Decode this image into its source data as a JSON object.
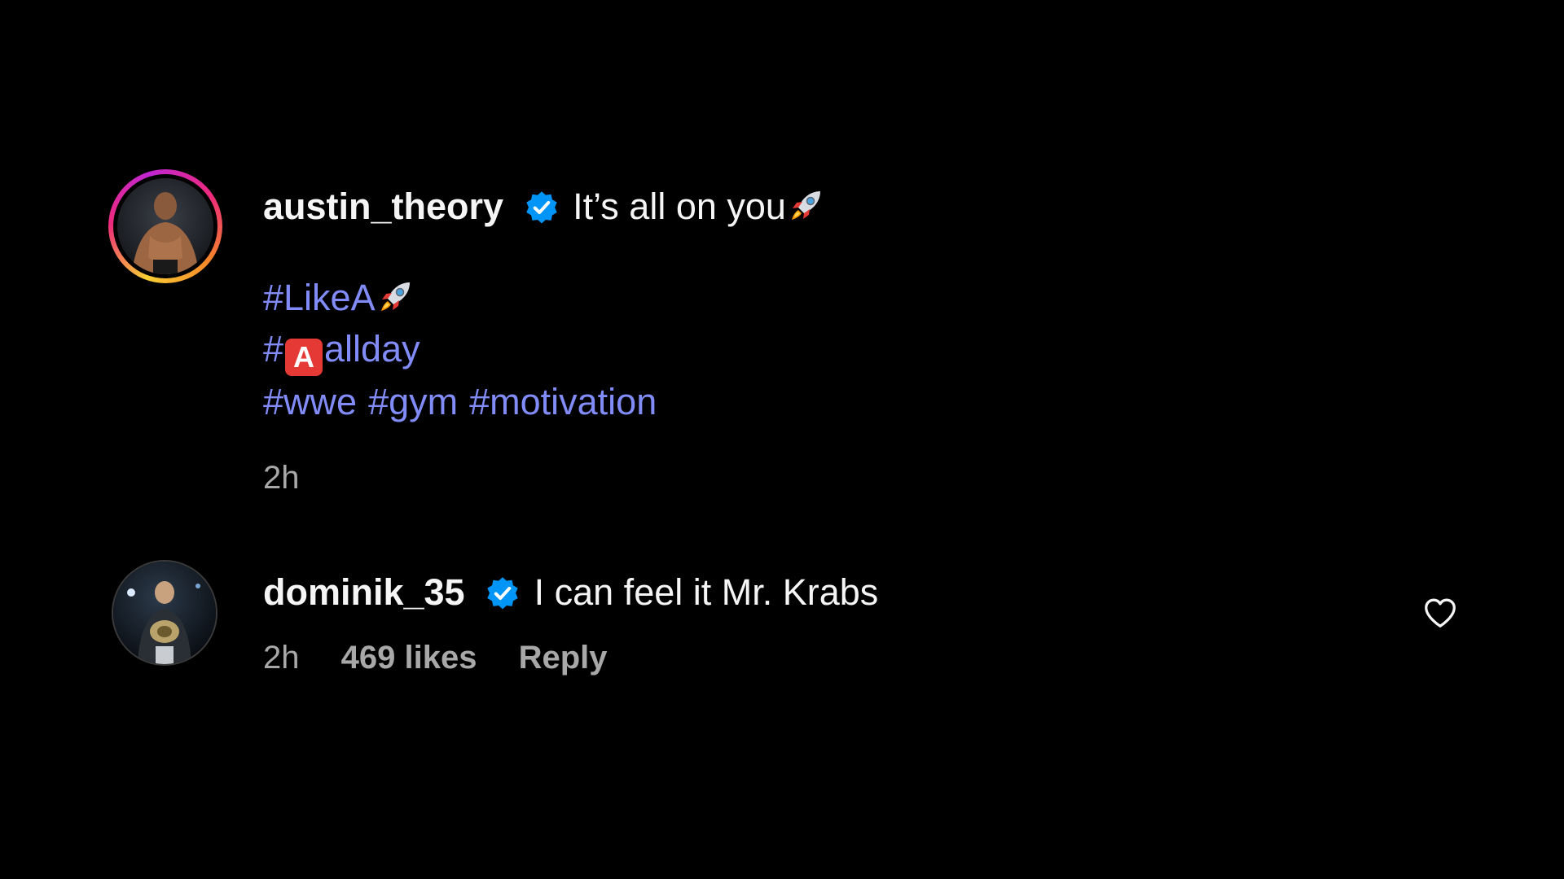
{
  "post": {
    "username": "austin_theory",
    "caption": "It’s all on you",
    "hashtags_line1": "#LikeA",
    "hashtags_line2_prefix": "#",
    "hashtags_line2_suffix": "allday",
    "hashtags_line2_emoji": "A",
    "hashtags_line3": [
      "#wwe",
      "#gym",
      "#motivation"
    ],
    "time": "2h"
  },
  "comment": {
    "username": "dominik_35",
    "text": "I can feel it Mr. Krabs",
    "time": "2h",
    "likes": "469 likes",
    "reply_label": "Reply"
  },
  "icons": {
    "verified": "verified-badge-icon",
    "heart": "heart-outline-icon",
    "rocket": "rocket-emoji-icon"
  },
  "colors": {
    "background": "#000000",
    "text": "#f5f5f5",
    "hashtag": "#818cf8",
    "muted": "#a8a8a8",
    "verified": "#0095f6"
  }
}
